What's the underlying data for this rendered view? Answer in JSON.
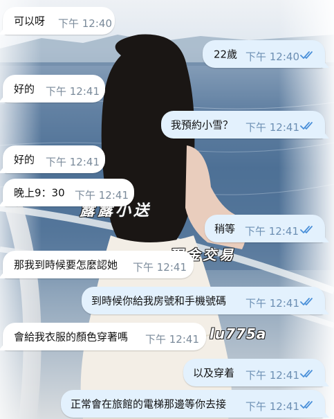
{
  "colors": {
    "incoming_bubble": "#ffffff",
    "outgoing_bubble": "#e3f1fd",
    "outgoing_time": "#6c8fb3",
    "read_checks": "#4a90d9"
  },
  "watermarks": [
    "露露小送",
    "現金交易",
    "lu775a"
  ],
  "messages": [
    {
      "dir": "in",
      "text": "可以呀",
      "time": "下午 12:40"
    },
    {
      "dir": "out",
      "text": "22歲",
      "time": "下午 12:40",
      "status": "read"
    },
    {
      "dir": "in",
      "text": "好的",
      "time": "下午 12:41"
    },
    {
      "dir": "out",
      "text": "我預約小雪？",
      "time": "下午 12:41",
      "status": "read"
    },
    {
      "dir": "in",
      "text": "好的",
      "time": "下午 12:41"
    },
    {
      "dir": "in",
      "text": "晚上9：30",
      "time": "下午 12:41"
    },
    {
      "dir": "out",
      "text": "稍等",
      "time": "下午 12:41",
      "status": "read"
    },
    {
      "dir": "in",
      "text": "那我到時候要怎麼認她",
      "time": "下午 12:41"
    },
    {
      "dir": "out",
      "text": "到時候你給我房號和手機號碼",
      "time": "下午 12:41",
      "status": "read"
    },
    {
      "dir": "in",
      "text": "會給我衣服的顏色穿著嗎",
      "time": "下午 12:41"
    },
    {
      "dir": "out",
      "text": "以及穿着",
      "time": "下午 12:41",
      "status": "read"
    },
    {
      "dir": "out",
      "text": "正常會在旅館的電梯那邊等你去接",
      "time": "下午 12:41",
      "status": "read"
    }
  ]
}
